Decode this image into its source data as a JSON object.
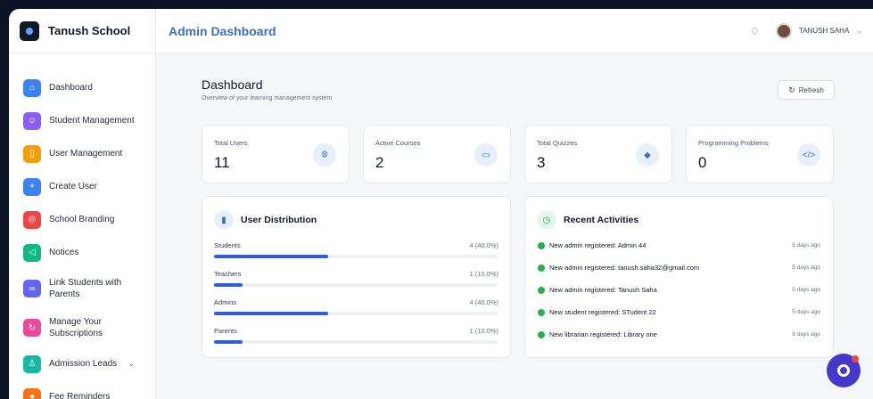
{
  "brand": {
    "name": "Tanush School"
  },
  "header": {
    "title": "Admin Dashboard",
    "user_name": "TANUSH SAHA"
  },
  "sidebar": {
    "items": [
      {
        "label": "Dashboard",
        "icon": "home-icon",
        "color": "#3b82f6"
      },
      {
        "label": "Student Management",
        "icon": "users-icon",
        "color": "#8b5cf6"
      },
      {
        "label": "User Management",
        "icon": "book-icon",
        "color": "#f59e0b"
      },
      {
        "label": "Create User",
        "icon": "user-plus-icon",
        "color": "#3b82f6"
      },
      {
        "label": "School Branding",
        "icon": "palette-icon",
        "color": "#ef4444"
      },
      {
        "label": "Notices",
        "icon": "megaphone-icon",
        "color": "#10b981"
      },
      {
        "label": "Link Students with Parents",
        "icon": "link-icon",
        "color": "#6366f1"
      },
      {
        "label": "Manage Your Subscriptions",
        "icon": "refresh-icon",
        "color": "#ec4899"
      },
      {
        "label": "Admission Leads",
        "icon": "user-add-icon",
        "color": "#14b8a6"
      },
      {
        "label": "Fee Reminders",
        "icon": "coin-icon",
        "color": "#f97316"
      }
    ]
  },
  "main": {
    "title": "Dashboard",
    "subtitle": "Overview of your learning management system",
    "refresh_label": "Refresh",
    "stats": [
      {
        "label": "Total Users",
        "value": "11",
        "icon": "users-icon"
      },
      {
        "label": "Active Courses",
        "value": "2",
        "icon": "book-icon"
      },
      {
        "label": "Total Quizzes",
        "value": "3",
        "icon": "graduation-cap-icon"
      },
      {
        "label": "Programming Problems",
        "value": "0",
        "icon": "code-icon"
      }
    ],
    "distribution": {
      "title": "User Distribution",
      "rows": [
        {
          "label": "Students",
          "value": "4 (40.0%)",
          "fraction": 0.4
        },
        {
          "label": "Teachers",
          "value": "1 (10.0%)",
          "fraction": 0.1
        },
        {
          "label": "Admins",
          "value": "4 (40.0%)",
          "fraction": 0.4
        },
        {
          "label": "Parents",
          "value": "1 (10.0%)",
          "fraction": 0.1
        }
      ]
    },
    "activities": {
      "title": "Recent Activities",
      "items": [
        {
          "text": "New admin registered: Admin 44",
          "time": "5 days ago"
        },
        {
          "text": "New admin registered: tanush.saha32@gmail.com",
          "time": "5 days ago"
        },
        {
          "text": "New admin registered: Tanush Saha",
          "time": "5 days ago"
        },
        {
          "text": "New student registered: STudent 22",
          "time": "5 days ago"
        },
        {
          "text": "New librarian registered: Library one",
          "time": "9 days ago"
        }
      ]
    }
  },
  "colors": {
    "accent": "#3b6fc9",
    "bar": "#2f5fd0",
    "activity_dot": "#22b14c",
    "fab": "#4338ca"
  }
}
